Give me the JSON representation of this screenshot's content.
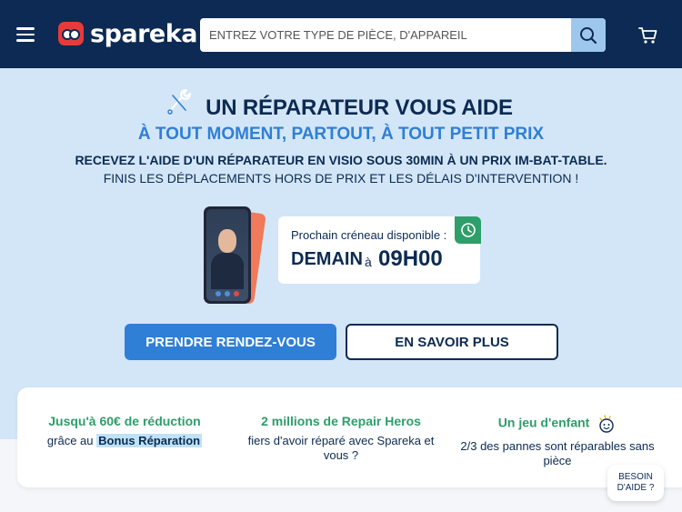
{
  "header": {
    "logo_text": "spareka",
    "search_placeholder": "ENTREZ VOTRE TYPE DE PIÈCE, D'APPAREIL"
  },
  "hero": {
    "title": "UN RÉPARATEUR VOUS AIDE",
    "subtitle": "À TOUT MOMENT, PARTOUT, À TOUT PETIT PRIX",
    "line1": "RECEVEZ L'AIDE D'UN RÉPARATEUR EN VISIO SOUS 30MIN À UN PRIX IM-BAT-TABLE.",
    "line2": "FINIS LES DÉPLACEMENTS HORS DE PRIX ET LES DÉLAIS D'INTERVENTION !",
    "slot": {
      "label": "Prochain créneau disponible :",
      "day": "DEMAIN",
      "connector": "à",
      "time": "09H00"
    },
    "cta_primary": "PRENDRE RENDEZ-VOUS",
    "cta_secondary": "EN SAVOIR PLUS"
  },
  "features": [
    {
      "title": "Jusqu'à 60€ de réduction",
      "text_pre": "grâce au",
      "text_highlight": "Bonus Réparation"
    },
    {
      "title": "2 millions de Repair Heros",
      "text": "fiers d'avoir réparé avec Spareka et vous ?"
    },
    {
      "title": "Un jeu d'enfant",
      "text": "2/3 des pannes sont réparables sans pièce"
    }
  ],
  "help_button": {
    "line1": "BESOIN",
    "line2": "D'AIDE ?"
  },
  "colors": {
    "navy": "#0c2a53",
    "accent_blue": "#2f7fd6",
    "hero_bg": "#d3e6f7",
    "green": "#2e9e6a"
  }
}
